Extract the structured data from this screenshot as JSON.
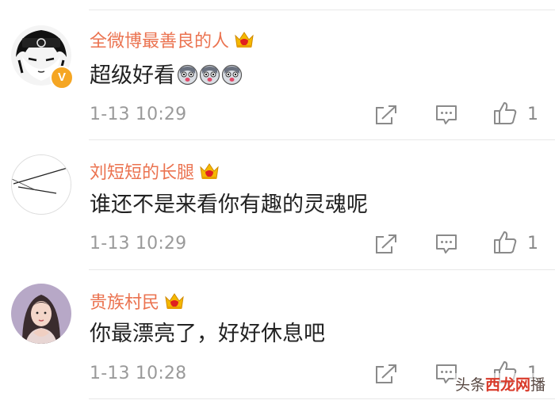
{
  "comments": [
    {
      "username": "全微博最善良的人",
      "text": "超级好看",
      "time": "1-13 10:29",
      "likes": "1",
      "avatar_icon": "naruto-anime-avatar",
      "verified_badge": "V",
      "emoji_count": 3
    },
    {
      "username": "刘短短的长腿",
      "text": "谁还不是来看你有趣的灵魂呢",
      "time": "1-13 10:29",
      "likes": "1",
      "avatar_icon": "sketch-lines-avatar"
    },
    {
      "username": "贵族村民",
      "text": "你最漂亮了，好好休息吧",
      "time": "1-13 10:28",
      "likes": "1",
      "avatar_icon": "girl-photo-avatar"
    }
  ],
  "watermark": {
    "prefix": "头条",
    "brand": "西龙网",
    "suffix": "播"
  },
  "colors": {
    "username": "#eb7350",
    "text": "#222222",
    "meta": "#9a9a9a",
    "crown_gold": "#f5b800",
    "crown_red": "#e02020"
  },
  "icons": {
    "share": "share-icon",
    "comment": "comment-icon",
    "like": "thumbs-up-icon",
    "crown": "crown-badge-icon"
  }
}
